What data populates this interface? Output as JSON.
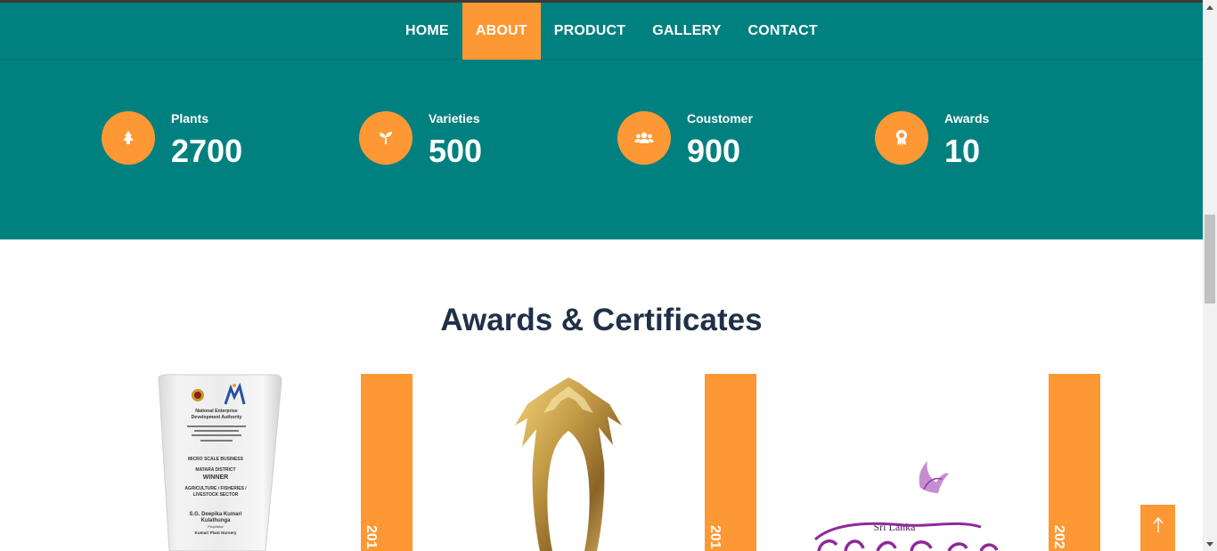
{
  "nav": {
    "items": [
      {
        "label": "HOME",
        "active": false
      },
      {
        "label": "ABOUT",
        "active": true
      },
      {
        "label": "PRODUCT",
        "active": false
      },
      {
        "label": "GALLERY",
        "active": false
      },
      {
        "label": "CONTACT",
        "active": false
      }
    ]
  },
  "stats": [
    {
      "label": "Plants",
      "value": "2700",
      "icon": "tree-icon"
    },
    {
      "label": "Varieties",
      "value": "500",
      "icon": "sprout-icon"
    },
    {
      "label": "Coustomer",
      "value": "900",
      "icon": "users-icon"
    },
    {
      "label": "Awards",
      "value": "10",
      "icon": "award-icon"
    }
  ],
  "awards": {
    "title": "Awards & Certificates",
    "items": [
      {
        "year": "201",
        "image": "crystal-plaque",
        "plaque_text": [
          "National Enterprise",
          "Development Authority",
          "MICRO SCALE BUSINESS",
          "MATARA DISTRICT",
          "WINNER",
          "AGRICULTURE / FISHERIES /",
          "LIVESTOCK SECTOR",
          "S.G. Deepika Kumari",
          "Kulathunga",
          "Proprietor",
          "Kumari Plant Nursery"
        ]
      },
      {
        "year": "201",
        "image": "gold-trophy"
      },
      {
        "year": "202",
        "image": "sri-lanka-logo",
        "logo_text": "Sri Lanka"
      }
    ]
  },
  "colors": {
    "teal": "#018080",
    "orange": "#fd9834",
    "title": "#1f3047"
  },
  "scroll_top_icon": "arrow-up-icon"
}
